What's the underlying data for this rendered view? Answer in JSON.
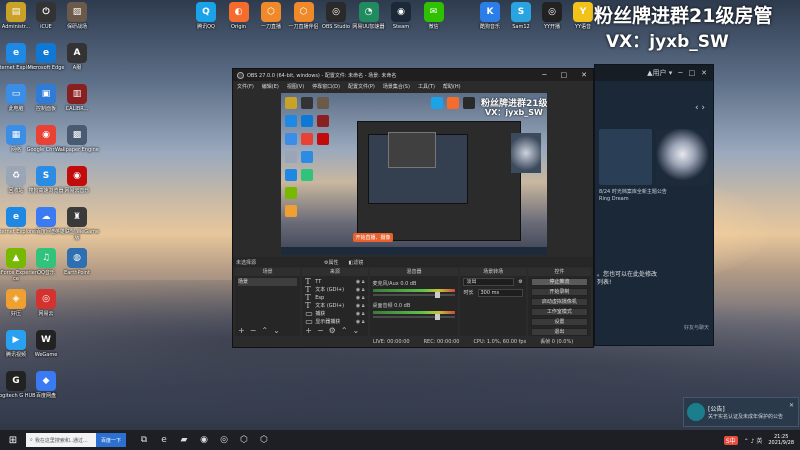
{
  "desktop": {
    "icons_col1": [
      {
        "label": "Administr...",
        "icon": "user-folder-icon",
        "color": "#c9a227",
        "glyph": "▤"
      },
      {
        "label": "Internet Explorer",
        "icon": "internet-explorer-icon",
        "color": "#1e88e5",
        "glyph": "e"
      },
      {
        "label": "此电脑",
        "icon": "this-pc-icon",
        "color": "#3a8ee6",
        "glyph": "▭"
      },
      {
        "label": "网络",
        "icon": "network-icon",
        "color": "#3a8ee6",
        "glyph": "▦"
      },
      {
        "label": "回收站",
        "icon": "recycle-bin-icon",
        "color": "#9aa6b5",
        "glyph": "♻"
      },
      {
        "label": "Internet Explorer",
        "icon": "internet-explorer-icon-2",
        "color": "#1e88e5",
        "glyph": "e"
      },
      {
        "label": "GeForce Experience",
        "icon": "geforce-icon",
        "color": "#76b900",
        "glyph": "▲"
      },
      {
        "label": "好压",
        "icon": "haozip-icon",
        "color": "#f0a030",
        "glyph": "◈"
      },
      {
        "label": "腾讯视频",
        "icon": "tencent-video-icon",
        "color": "#2aa1f0",
        "glyph": "▶"
      },
      {
        "label": "Logitech G HUB",
        "icon": "logitech-icon",
        "color": "#222222",
        "glyph": "G"
      }
    ],
    "icons_col2": [
      {
        "label": "iCUE",
        "icon": "icue-icon",
        "color": "#333333",
        "glyph": "⏻"
      },
      {
        "label": "Microsoft Edge",
        "icon": "edge-icon",
        "color": "#0f78d4",
        "glyph": "e"
      },
      {
        "label": "控制面板",
        "icon": "control-panel-icon",
        "color": "#2f7bd6",
        "glyph": "▣"
      },
      {
        "label": "Google Chrome",
        "icon": "chrome-icon",
        "color": "#e94235",
        "glyph": "◉"
      },
      {
        "label": "搜狗高速浏览器",
        "icon": "sogou-icon",
        "color": "#2c8be3",
        "glyph": "S"
      },
      {
        "label": "百度网盘",
        "icon": "baidu-disk-icon",
        "color": "#3a7af2",
        "glyph": "☁"
      },
      {
        "label": "QQ音乐",
        "icon": "qq-music-icon",
        "color": "#31c27c",
        "glyph": "♫"
      },
      {
        "label": "网易云",
        "icon": "netease-icon",
        "color": "#d4322e",
        "glyph": "◎"
      },
      {
        "label": "WeGame",
        "icon": "wegame-icon",
        "color": "#222222",
        "glyph": "W"
      },
      {
        "label": "百度网盘",
        "icon": "baidu-icon-2",
        "color": "#3a7af2",
        "glyph": "◆"
      }
    ],
    "icons_col3": [
      {
        "label": "保研战场",
        "icon": "game-photo-icon",
        "color": "#6b5a4a",
        "glyph": "▨"
      },
      {
        "label": "A服",
        "icon": "game-a-icon",
        "color": "#333333",
        "glyph": "A"
      },
      {
        "label": "CALIBR...",
        "icon": "calibre-icon",
        "color": "#8a1f1f",
        "glyph": "▥"
      },
      {
        "label": "Wallpaper Engine",
        "icon": "wallpaper-icon",
        "color": "#4a5a70",
        "glyph": "▩"
      },
      {
        "label": "网易云音乐",
        "icon": "netease-music-icon",
        "color": "#c20c0c",
        "glyph": "◉"
      },
      {
        "label": "英雄联盟 WeGame版",
        "icon": "lol-icon",
        "color": "#3a3a3a",
        "glyph": "♜"
      },
      {
        "label": "EarthPoint",
        "icon": "earth-icon",
        "color": "#2d6fb0",
        "glyph": "◍"
      }
    ],
    "top_icons": [
      {
        "label": "腾讯QQ",
        "icon": "qq-icon",
        "color": "#1aa3e8",
        "glyph": "Q"
      },
      {
        "label": "Origin",
        "icon": "origin-icon",
        "color": "#f56c2d",
        "glyph": "◐"
      },
      {
        "label": "一刀直播",
        "icon": "live-icon",
        "color": "#f0892a",
        "glyph": "⬡"
      },
      {
        "label": "一刀直播伴侣",
        "icon": "live-icon-2",
        "color": "#f0892a",
        "glyph": "⬡"
      },
      {
        "label": "OBS Studio",
        "icon": "obs-icon",
        "color": "#2a2a2a",
        "glyph": "◎"
      },
      {
        "label": "网易UU加速器",
        "icon": "uu-icon",
        "color": "#1f8b5f",
        "glyph": "◔"
      },
      {
        "label": "Steam",
        "icon": "steam-icon",
        "color": "#1b2838",
        "glyph": "◉"
      },
      {
        "label": "微信",
        "icon": "wechat-icon",
        "color": "#2dc100",
        "glyph": "✉"
      }
    ],
    "top_icons_right": [
      {
        "label": "酷狗音乐",
        "icon": "kugou-icon",
        "color": "#2b7de8",
        "glyph": "K"
      },
      {
        "label": "Sam12",
        "icon": "sam-icon",
        "color": "#2aa4e0",
        "glyph": "S"
      },
      {
        "label": "YY开播",
        "icon": "yy-icon",
        "color": "#222222",
        "glyph": "◎"
      },
      {
        "label": "YY语音",
        "icon": "yy-voice-icon",
        "color": "#f2c21b",
        "glyph": "Y"
      }
    ]
  },
  "promo": {
    "line1": "粉丝牌进群21级房管",
    "line2": "VX：jyxb_SW"
  },
  "steam": {
    "topbar_user": "▲用户 ▾",
    "arrows": "‹   ›",
    "caption": "8/24 时光档案库全新主题公告",
    "caption_sub": "Ring Dream",
    "tip": "。您也可以在此处修改\n列表!",
    "side_text": "好友与聊天",
    "icons": {
      "minimize": "─",
      "maximize": "□",
      "close": "✕"
    }
  },
  "obs": {
    "title": "OBS 27.0.0 (64-bit, windows) - 配置文件: 未命名 - 场景: 未命名",
    "menu": [
      "文件(F)",
      "编辑(E)",
      "视图(V)",
      "停靠窗口(D)",
      "配置文件(P)",
      "场景集合(S)",
      "工具(T)",
      "帮助(H)"
    ],
    "window_controls": [
      "─",
      "□",
      "✕"
    ],
    "preview_promo1": "粉丝牌进群21级房管",
    "preview_promo2": "VX：jyxb_SW",
    "preview_button": "开始直播、摄像",
    "scene_bar_label": "未选择源",
    "scene_bar_props": "⚙属性",
    "scene_bar_filters": "◧滤镜",
    "docks": {
      "scenes_title": "场景",
      "scene_item": "场景",
      "sources_title": "来源",
      "sources": [
        {
          "type": "T",
          "name": "TT"
        },
        {
          "type": "T",
          "name": "文本 (GDI+)"
        },
        {
          "type": "T",
          "name": "Esp"
        },
        {
          "type": "T",
          "name": "文本 (GDI+)"
        },
        {
          "type": "▭",
          "name": "捕获"
        },
        {
          "type": "▭",
          "name": "显示器捕获"
        }
      ],
      "mixer_title": "混音器",
      "mixer": [
        {
          "name": "麦克风/Aux",
          "db": "0.0 dB"
        },
        {
          "name": "桌面音频",
          "db": "0.0 dB"
        }
      ],
      "transitions_title": "场景转场",
      "transition_type": "淡出",
      "duration_label": "时长",
      "duration_value": "300 ms",
      "controls_title": "控件",
      "controls": [
        "停止推流",
        "开始录制",
        "启动虚拟摄像机",
        "工作室模式",
        "设置",
        "退出"
      ]
    },
    "status": {
      "live": "LIVE: 00:00:00",
      "rec": "REC: 00:00:00",
      "cpu": "CPU: 1.0%, 60.00 fps",
      "dropped": "丢帧 0 (0.0%)"
    }
  },
  "notification": {
    "header": "[公告]",
    "text": "关于实名认证及未成年保护的公告"
  },
  "taskbar": {
    "search_placeholder": "我在这里搜索和..通过...",
    "search_button": "百度一下",
    "apps": [
      {
        "icon": "task-view-icon",
        "glyph": "⧉"
      },
      {
        "icon": "edge-taskbar-icon",
        "glyph": "e"
      },
      {
        "icon": "folder-taskbar-icon",
        "glyph": "▰"
      },
      {
        "icon": "steam-taskbar-icon",
        "glyph": "◉"
      },
      {
        "icon": "obs-taskbar-icon",
        "glyph": "◎"
      },
      {
        "icon": "live-taskbar-icon",
        "glyph": "⬡"
      },
      {
        "icon": "live2-taskbar-icon",
        "glyph": "⬡"
      }
    ],
    "tray_badge": "S中",
    "tray_symbols": "⌃ ♪ 英",
    "time": "21:25",
    "date": "2021/9/28"
  }
}
